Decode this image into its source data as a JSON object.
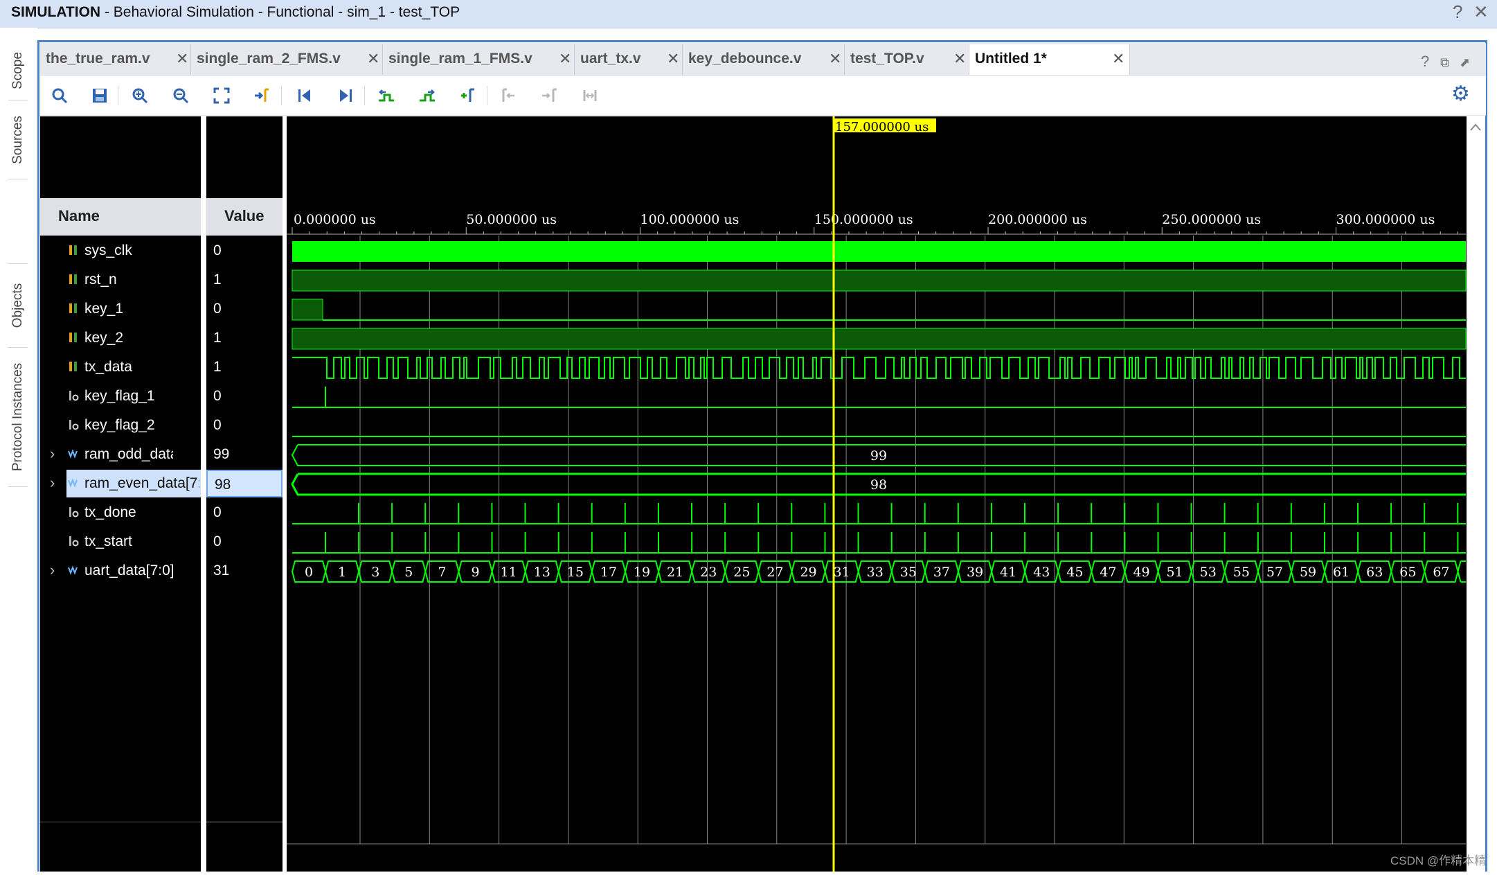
{
  "window": {
    "title_bold": "SIMULATION",
    "title_rest": " - Behavioral Simulation - Functional - sim_1 - test_TOP",
    "help_icon": "?",
    "close_icon": "✕"
  },
  "side_tabs": [
    "Scope",
    "Sources",
    "Objects",
    "Protocol Instances"
  ],
  "tabs": [
    {
      "label": "the_true_ram.v",
      "active": false
    },
    {
      "label": "single_ram_2_FMS.v",
      "active": false
    },
    {
      "label": "single_ram_1_FMS.v",
      "active": false
    },
    {
      "label": "uart_tx.v",
      "active": false
    },
    {
      "label": "key_debounce.v",
      "active": false
    },
    {
      "label": "test_TOP.v",
      "active": false
    },
    {
      "label": "Untitled 1*",
      "active": true
    }
  ],
  "toolbar": [
    "search-icon",
    "save-icon",
    "zoom-in-icon",
    "zoom-out-icon",
    "zoom-fit-icon",
    "go-to-cursor-icon",
    "go-to-start-icon",
    "go-to-end-icon",
    "previous-transition-icon",
    "next-transition-icon",
    "add-marker-icon",
    "previous-marker-icon",
    "next-marker-icon",
    "swap-cursors-icon",
    "settings-icon"
  ],
  "columns": {
    "name": "Name",
    "value": "Value"
  },
  "signals": [
    {
      "name": "sys_clk",
      "value": "0",
      "kind": "input",
      "expandable": false,
      "selected": false
    },
    {
      "name": "rst_n",
      "value": "1",
      "kind": "input",
      "expandable": false,
      "selected": false
    },
    {
      "name": "key_1",
      "value": "0",
      "kind": "input",
      "expandable": false,
      "selected": false
    },
    {
      "name": "key_2",
      "value": "1",
      "kind": "input",
      "expandable": false,
      "selected": false
    },
    {
      "name": "tx_data",
      "value": "1",
      "kind": "input",
      "expandable": false,
      "selected": false
    },
    {
      "name": "key_flag_1",
      "value": "0",
      "kind": "output",
      "expandable": false,
      "selected": false
    },
    {
      "name": "key_flag_2",
      "value": "0",
      "kind": "output",
      "expandable": false,
      "selected": false
    },
    {
      "name": "ram_odd_data[7:0]",
      "value": "99",
      "kind": "bus",
      "expandable": true,
      "selected": false
    },
    {
      "name": "ram_even_data[7:0]",
      "value": "98",
      "kind": "bus",
      "expandable": true,
      "selected": true
    },
    {
      "name": "tx_done",
      "value": "0",
      "kind": "output",
      "expandable": false,
      "selected": false
    },
    {
      "name": "tx_start",
      "value": "0",
      "kind": "output",
      "expandable": false,
      "selected": false
    },
    {
      "name": "uart_data[7:0]",
      "value": "31",
      "kind": "bus",
      "expandable": true,
      "selected": false
    }
  ],
  "cursor_label": "157.000000 us",
  "ruler_labels": [
    "0.000000 us",
    "50.000000 us",
    "100.000000 us",
    "150.000000 us",
    "200.000000 us",
    "250.000000 us",
    "300.000000 us"
  ],
  "bus_values": {
    "ram_odd": "99",
    "ram_even": "98"
  },
  "uart_sequence": [
    "0",
    "1",
    "3",
    "5",
    "7",
    "9",
    "11",
    "13",
    "15",
    "17",
    "19",
    "21",
    "23",
    "25",
    "27",
    "29",
    "31",
    "33",
    "35",
    "37",
    "39",
    "41",
    "43",
    "45",
    "47",
    "49",
    "51",
    "53",
    "55",
    "57",
    "59",
    "61",
    "63",
    "65",
    "67"
  ],
  "colors": {
    "wave_green": "#00ff00",
    "dark_green": "#0a5a0a",
    "cursor": "#ffff00",
    "frame_blue": "#4a82c9"
  },
  "watermark": "CSDN @作精本精"
}
